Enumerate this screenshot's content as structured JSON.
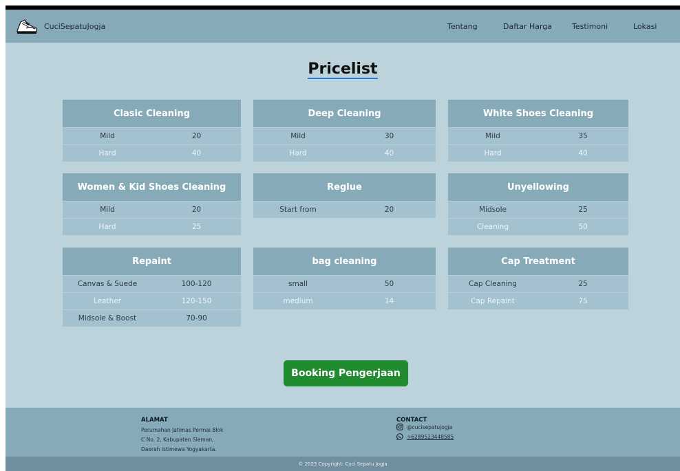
{
  "ghost_header": "Daftar Harga",
  "navbar": {
    "brand": "CuciSepatuJogja",
    "links": [
      "Tentang",
      "Daftar Harga",
      "Testimoni",
      "Lokasi"
    ]
  },
  "page_title": "Pricelist",
  "cards": [
    {
      "title": "Clasic Cleaning",
      "rows": [
        {
          "k": "Mild",
          "v": "20"
        },
        {
          "k": "Hard",
          "v": "40"
        }
      ]
    },
    {
      "title": "Deep Cleaning",
      "rows": [
        {
          "k": "Mild",
          "v": "30"
        },
        {
          "k": "Hard",
          "v": "40"
        }
      ]
    },
    {
      "title": "White Shoes Cleaning",
      "rows": [
        {
          "k": "Mild",
          "v": "35"
        },
        {
          "k": "Hard",
          "v": "40"
        }
      ]
    },
    {
      "title": "Women & Kid Shoes Cleaning",
      "rows": [
        {
          "k": "Mild",
          "v": "20"
        },
        {
          "k": "Hard",
          "v": "25"
        }
      ]
    },
    {
      "title": "Reglue",
      "rows": [
        {
          "k": "Start from",
          "v": "20"
        }
      ]
    },
    {
      "title": "Unyellowing",
      "rows": [
        {
          "k": "Midsole",
          "v": "25"
        },
        {
          "k": "Cleaning",
          "v": "50"
        }
      ]
    },
    {
      "title": "Repaint",
      "rows": [
        {
          "k": "Canvas & Suede",
          "v": "100-120"
        },
        {
          "k": "Leather",
          "v": "120-150"
        },
        {
          "k": "Midsole & Boost",
          "v": "70-90"
        }
      ]
    },
    {
      "title": "bag cleaning",
      "rows": [
        {
          "k": "small",
          "v": "50"
        },
        {
          "k": "medium",
          "v": "14"
        }
      ]
    },
    {
      "title": "Cap Treatment",
      "rows": [
        {
          "k": "Cap Cleaning",
          "v": "25"
        },
        {
          "k": "Cap Repaint",
          "v": "75"
        }
      ]
    }
  ],
  "booking_button": "Booking Pengerjaan",
  "footer": {
    "address_title": "ALAMAT",
    "address_lines": [
      "Perumahan Jatimas Permai Blok",
      "C No. 2, Kabupaten Sleman,",
      "Daerah Istimewa Yogyakarta."
    ],
    "contact_title": "CONTACT",
    "instagram": "@cucisepatujogja",
    "whatsapp": "+6289523448585",
    "copyright": "© 2023 Copyright: Cuci Sepatu Jogja"
  },
  "colors": {
    "navbar": "#87aab9",
    "background": "#bcd3db",
    "card_header": "#87aab9",
    "row": "#a4c1d0",
    "button": "#218c2f",
    "footer": "#87aab9",
    "copyright_bar": "#6f8f9e"
  },
  "icons": {
    "brand": "sneaker-logo-icon",
    "instagram": "instagram-icon",
    "whatsapp": "whatsapp-icon"
  }
}
